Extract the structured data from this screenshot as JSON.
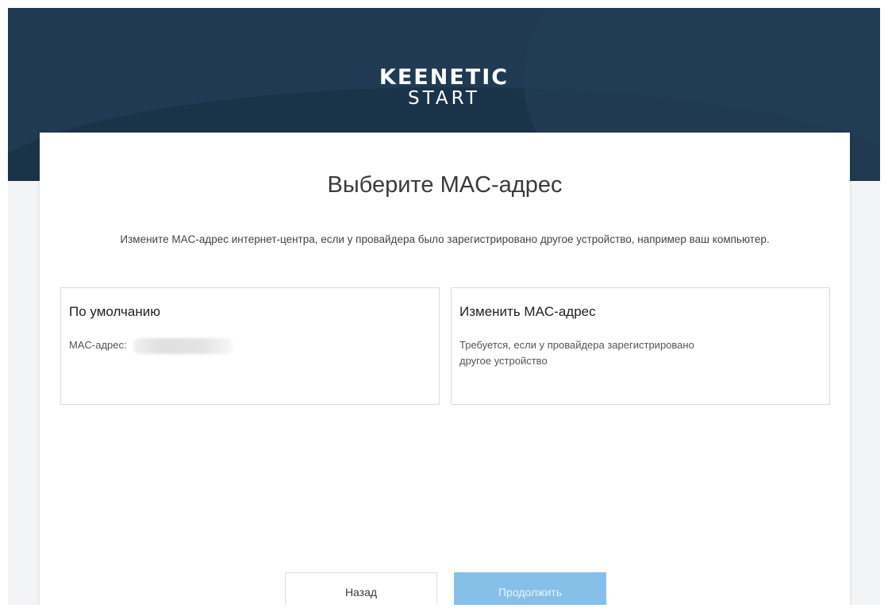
{
  "logo": {
    "brand": "KEENETIC",
    "sub": "START"
  },
  "title": "Выберите MAC-адрес",
  "description": "Измените MAC-адрес интернет-центра, если у провайдера было зарегистрировано другое устройство, например ваш компьютер.",
  "options": [
    {
      "title": "По умолчанию",
      "label": "MAC-адрес:",
      "value_hidden": true
    },
    {
      "title": "Изменить MAC-адрес",
      "text": "Требуется, если у провайдера зарегистрировано другое устройство"
    }
  ],
  "buttons": {
    "back": "Назад",
    "next": "Продолжить"
  },
  "colors": {
    "header": "#1f3a52",
    "primary_button": "#86c0e8",
    "card": "#ffffff",
    "background": "#f3f4f6"
  }
}
